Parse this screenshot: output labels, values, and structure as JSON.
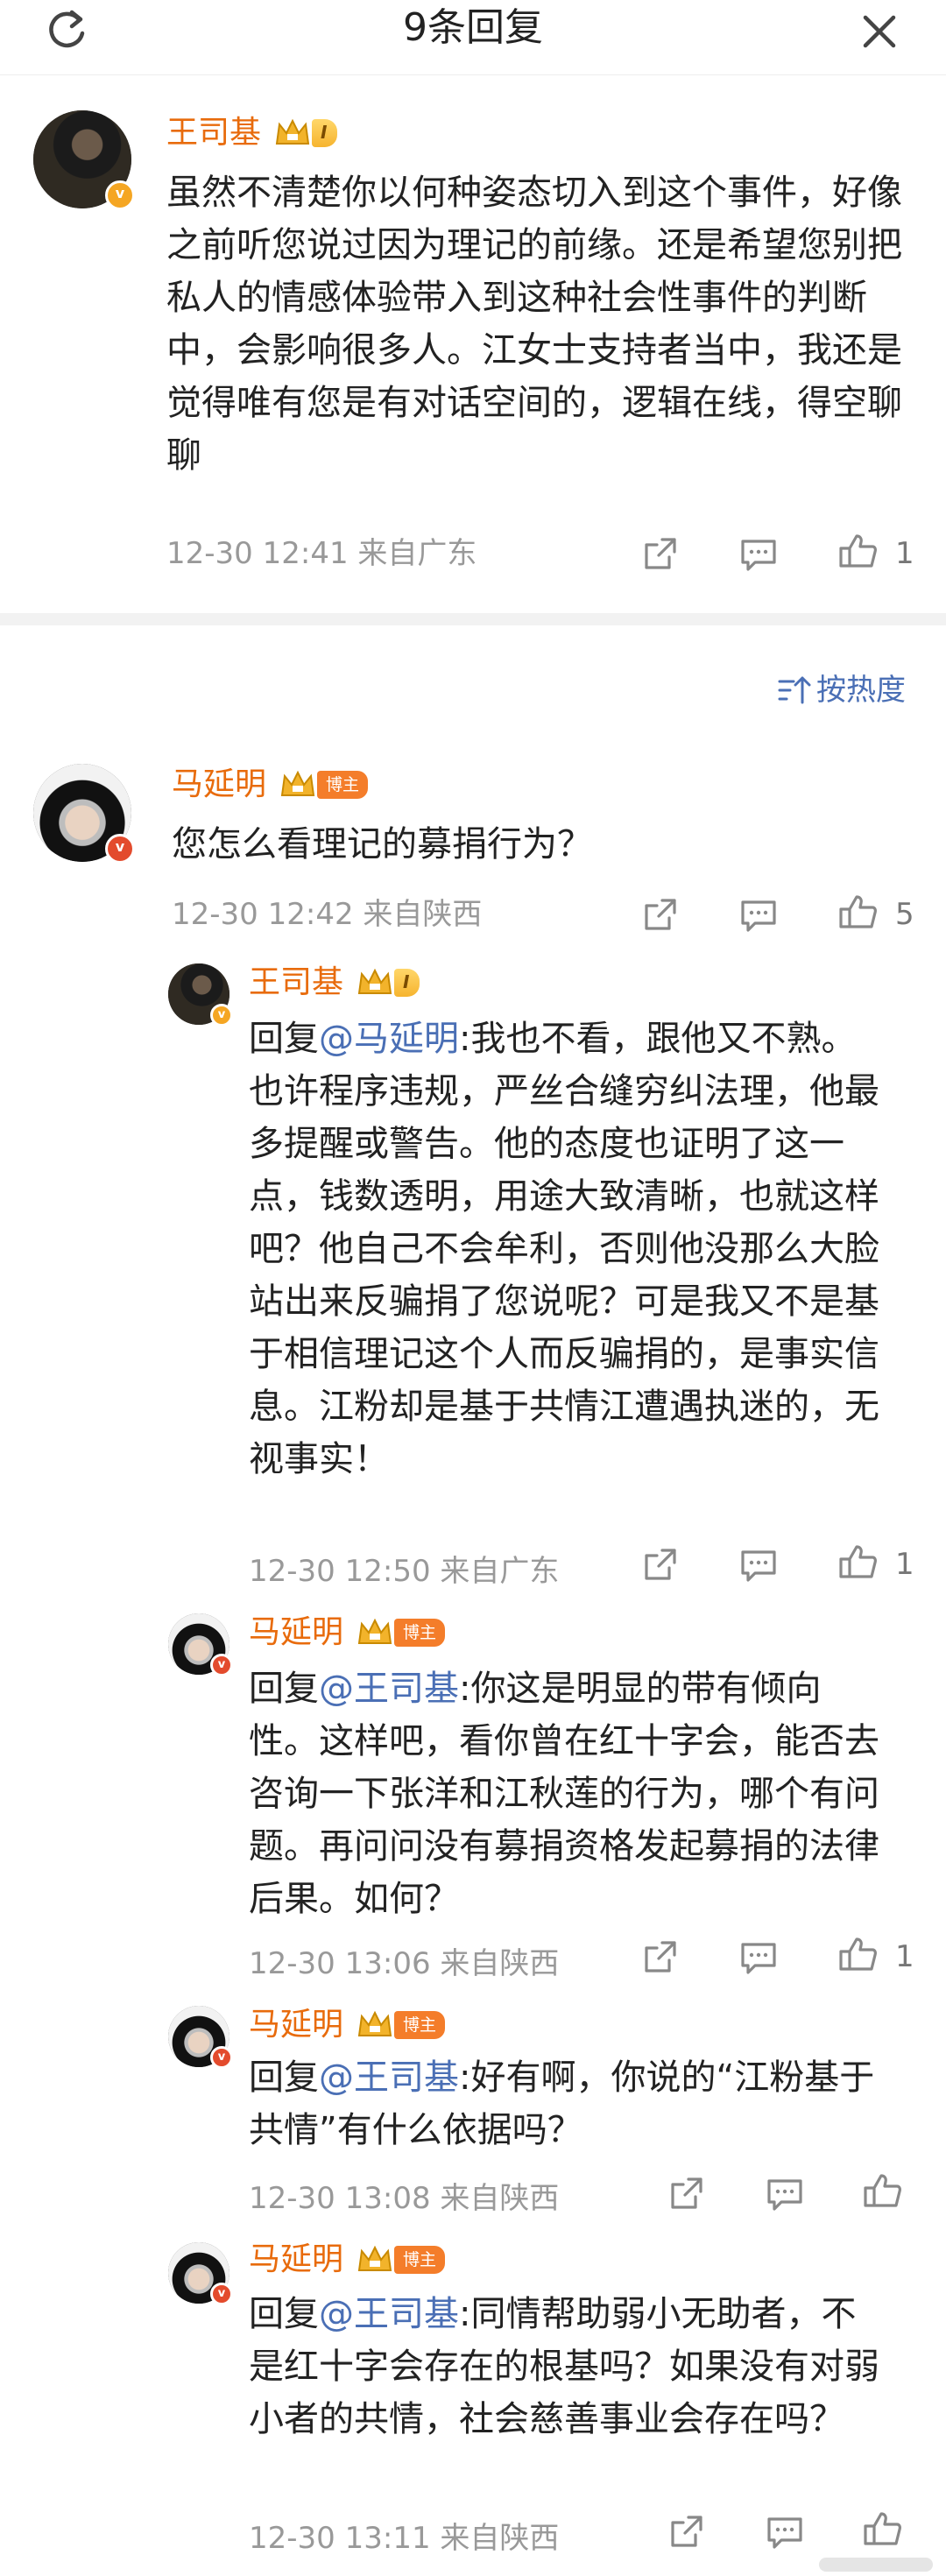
{
  "header": {
    "title": "9条回复"
  },
  "top_comment": {
    "name": "王司基",
    "level": "I",
    "text": "虽然不清楚你以何种姿态切入到这个事件，好像之前听您说过因为理记的前缘。还是希望您别把私人的情感体验带入到这种社会性事件的判断中，会影响很多人。江女士支持者当中，我还是觉得唯有您是有对话空间的，逻辑在线，得空聊聊",
    "time": "12-30 12:41 来自广东",
    "likes": "1"
  },
  "sort": {
    "label": "按热度"
  },
  "thread": {
    "root": {
      "name": "马延明",
      "tag": "博主",
      "text": "您怎么看理记的募捐行为？",
      "time": "12-30 12:42 来自陕西",
      "likes": "5"
    },
    "replies": [
      {
        "name": "王司基",
        "level": "I",
        "prefix": "回复",
        "mention": "@马延明",
        "text": ":我也不看，跟他又不熟。也许程序违规，严丝合缝穷纠法理，他最多提醒或警告。他的态度也证明了这一点，钱数透明，用途大致清晰，也就这样吧？他自己不会牟利，否则他没那么大脸站出来反骗捐了您说呢？可是我又不是基于相信理记这个人而反骗捐的，是事实信息。江粉却是基于共情江遭遇执迷的，无视事实！",
        "time": "12-30 12:50 来自广东",
        "likes": "1"
      },
      {
        "name": "马延明",
        "tag": "博主",
        "prefix": "回复",
        "mention": "@王司基",
        "text": ":你这是明显的带有倾向性。这样吧，看你曾在红十字会，能否去咨询一下张洋和江秋莲的行为，哪个有问题。再问问没有募捐资格发起募捐的法律后果。如何？",
        "time": "12-30 13:06 来自陕西",
        "likes": "1"
      },
      {
        "name": "马延明",
        "tag": "博主",
        "prefix": "回复",
        "mention": "@王司基",
        "text": ":好有啊，你说的“江粉基于共情”有什么依据吗？",
        "time": "12-30 13:08 来自陕西",
        "likes": ""
      },
      {
        "name": "马延明",
        "tag": "博主",
        "prefix": "回复",
        "mention": "@王司基",
        "text": ":同情帮助弱小无助者，不是红十字会存在的根基吗？如果没有对弱小者的共情，社会慈善事业会存在吗？",
        "time": "12-30 13:11 来自陕西",
        "likes": ""
      }
    ]
  }
}
